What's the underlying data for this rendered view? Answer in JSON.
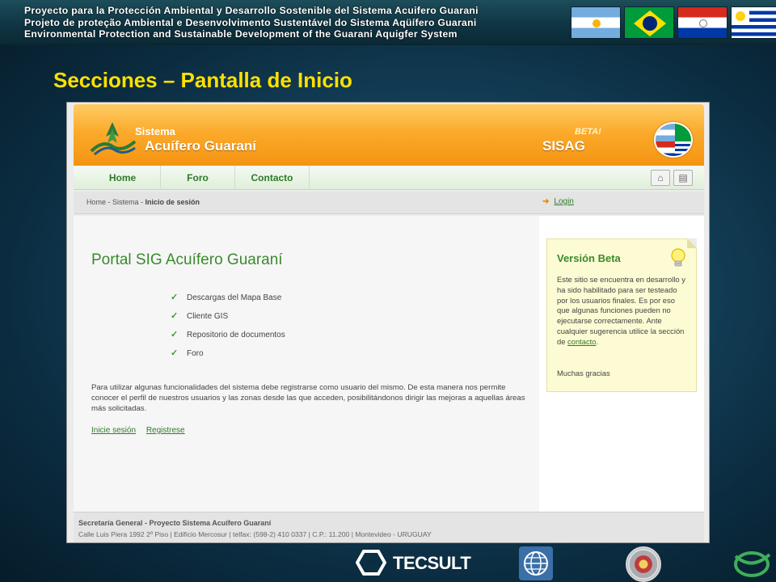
{
  "banner": {
    "line_es": "Proyecto para la Protección Ambiental y Desarrollo Sostenible del Sistema Acuifero Guarani",
    "line_pt": "Projeto de proteção Ambiental e Desenvolvimento Sustentável do Sistema Aqüífero Guarani",
    "line_en": "Environmental Protection and Sustainable Development of the Guarani Aquigfer System",
    "flags": [
      "argentina-flag",
      "brazil-flag",
      "paraguay-flag",
      "uruguay-flag"
    ]
  },
  "slide_title": "Secciones – Pantalla de Inicio",
  "site": {
    "logo_sistema": "Sistema",
    "logo_name": "Acuífero Guaraní",
    "beta_tag": "BETA!",
    "brand": "SISAG",
    "nav": {
      "home": "Home",
      "foro": "Foro",
      "contacto": "Contacto",
      "home_icon": "house-icon",
      "print_icon": "print-icon"
    },
    "breadcrumb": {
      "home": "Home",
      "sep": " - ",
      "sistema": "Sistema",
      "current": "Inicio de sesión"
    },
    "login": "Login",
    "main": {
      "title": "Portal SIG Acuífero Guaraní",
      "features": [
        "Descargas del Mapa Base",
        "Cliente GIS",
        "Repositorio de documentos",
        "Foro"
      ],
      "paragraph": "Para utilizar algunas funcionalidades del sistema debe registrarse como usuario del mismo. De esta manera nos permite conocer el perfil de nuestros usuarios y las zonas desde las que acceden, posibilitándonos dirigir las mejoras a aquellas áreas más solicitadas.",
      "link_login": "Inicie sesión",
      "link_register": "Registrese"
    },
    "sidebar": {
      "title": "Versión Beta",
      "text": "Este sitio se encuentra en desarrollo y ha sido habilitado para ser testeado por los usuarios finales. Es por eso que algunas funciones pueden no ejecutarse correctamente. Ante cualquier sugerencia utilice la sección de",
      "contact_link": "contacto",
      "text_end": ".",
      "thanks": "Muchas gracias"
    },
    "footer": {
      "org": "Secretaría General - Proyecto Sistema Acuífero Guaraní",
      "address": "Calle Luis Piera 1992 2º Piso   |   Edificio Mercosur   |   telfax: (598-2) 410 0337   |   C.P.: 11.200   |   Montevideo - URUGUAY"
    }
  },
  "logos": {
    "tecsult": "TECSULT",
    "others": [
      "world-bank-logo",
      "oas-logo",
      "gef-logo"
    ]
  },
  "colors": {
    "title_yellow": "#ffe000",
    "header_orange": "#f49411",
    "link_green": "#2f7a2a",
    "beta_box_bg": "#fdfbd3"
  }
}
